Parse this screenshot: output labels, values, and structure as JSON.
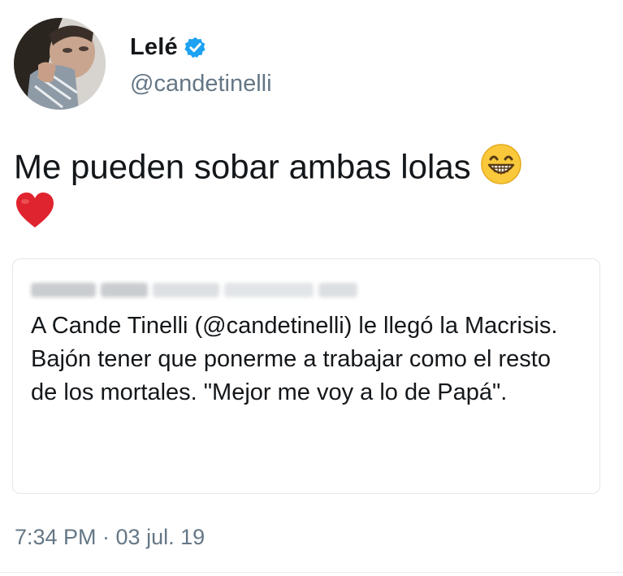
{
  "user": {
    "display_name": "Lelé",
    "handle": "@candetinelli",
    "verified_icon": "verified-badge-icon",
    "verified_color": "#1da1f2"
  },
  "tweet": {
    "text": "Me pueden sobar ambas lolas",
    "emojis": [
      "grinning-face-with-smiling-eyes-emoji",
      "red-heart-emoji"
    ],
    "timestamp": "7:34 PM · 03 jul. 19"
  },
  "quoted_tweet": {
    "author_redacted": true,
    "text": "A Cande Tinelli (@candetinelli) le llegó la Macrisis.\nBajón tener que ponerme a trabajar como el resto de los mortales. \"Mejor me voy a lo de Papá\"."
  },
  "colors": {
    "text_primary": "#14171a",
    "text_secondary": "#657786",
    "border": "#e1e8ed"
  }
}
